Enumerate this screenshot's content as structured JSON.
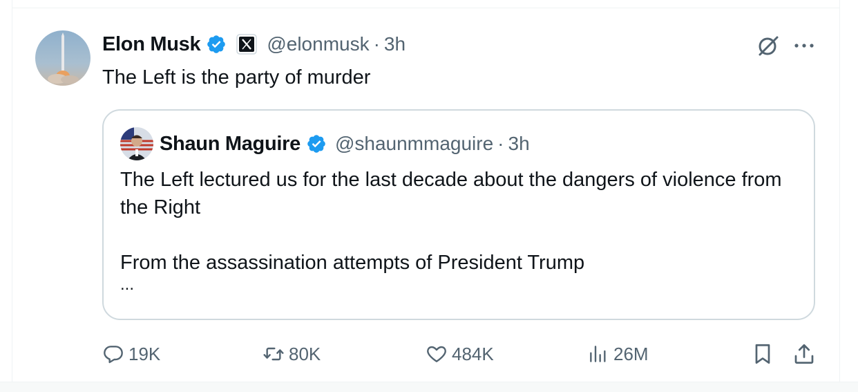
{
  "tweet": {
    "author_name": "Elon Musk",
    "handle": "@elonmusk",
    "separator": "·",
    "time": "3h",
    "text": "The Left is the party of murder"
  },
  "quoted": {
    "author_name": "Shaun Maguire",
    "handle": "@shaunmmaguire",
    "separator": "·",
    "time": "3h",
    "paragraphs": [
      "The Left lectured us for the last decade about the dangers of violence from the Right",
      "From the assassination attempts of President Trump"
    ],
    "ellipsis": "..."
  },
  "actions": {
    "replies": "19K",
    "reposts": "80K",
    "likes": "484K",
    "views": "26M"
  },
  "icons": {
    "verified": "verified-badge-icon",
    "affiliate": "x-logo-icon",
    "grok": "grok-icon",
    "more": "more-icon",
    "reply": "reply-icon",
    "repost": "repost-icon",
    "like": "heart-icon",
    "views": "views-icon",
    "bookmark": "bookmark-icon",
    "share": "share-icon"
  },
  "colors": {
    "verified": "#1d9bf0",
    "secondary_text": "#536471",
    "border": "#cfd9de"
  }
}
